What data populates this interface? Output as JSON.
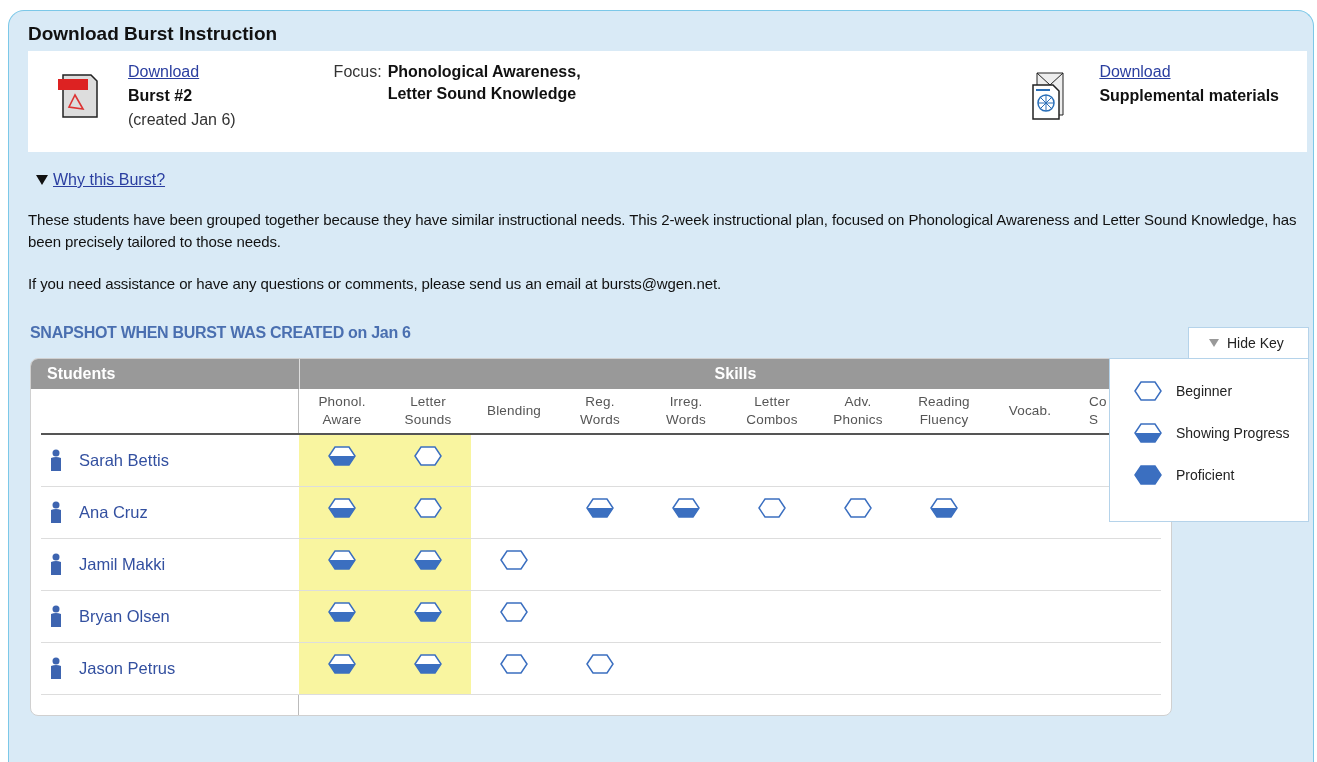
{
  "title": "Download Burst Instruction",
  "downloads": {
    "burst": {
      "link": "Download",
      "name": "Burst #2",
      "created": "(created Jan 6)"
    },
    "focus": {
      "label": "Focus:",
      "lines": [
        "Phonological Awareness,",
        "Letter Sound Knowledge"
      ]
    },
    "supplemental": {
      "link": "Download",
      "name": "Supplemental materials"
    }
  },
  "why": {
    "link": "Why this Burst?",
    "expanded": true
  },
  "paragraphs": [
    "These students have been grouped together because they have similar instructional needs. This 2-week instructional plan, focused on Phonological Awareness and Letter Sound Knowledge, has been precisely tailored to those needs.",
    "If you need assistance or have any questions or comments, please send us an email at bursts@wgen.net."
  ],
  "snapshot_heading": "SNAPSHOT WHEN BURST WAS CREATED on Jan 6",
  "key": {
    "button": "Hide Key",
    "expanded": true,
    "items": [
      {
        "kind": "beginner",
        "label": "Beginner"
      },
      {
        "kind": "progress",
        "label": "Showing Progress"
      },
      {
        "kind": "proficient",
        "label": "Proficient"
      }
    ]
  },
  "table": {
    "students_heading": "Students",
    "skills_heading": "Skills",
    "columns": [
      {
        "lines": [
          "Phonol.",
          "Aware"
        ],
        "highlighted": true
      },
      {
        "lines": [
          "Letter",
          "Sounds"
        ],
        "highlighted": true
      },
      {
        "lines": [
          "Blending"
        ],
        "highlighted": false
      },
      {
        "lines": [
          "Reg.",
          "Words"
        ],
        "highlighted": false
      },
      {
        "lines": [
          "Irreg.",
          "Words"
        ],
        "highlighted": false
      },
      {
        "lines": [
          "Letter",
          "Combos"
        ],
        "highlighted": false
      },
      {
        "lines": [
          "Adv.",
          "Phonics"
        ],
        "highlighted": false
      },
      {
        "lines": [
          "Reading",
          "Fluency"
        ],
        "highlighted": false
      },
      {
        "lines": [
          "Vocab."
        ],
        "highlighted": false
      },
      {
        "lines": [
          "Co",
          "S"
        ],
        "highlighted": false
      }
    ],
    "rows": [
      {
        "name": "Sarah Bettis",
        "skills": [
          {
            "kind": "progress"
          },
          {
            "kind": "beginner"
          },
          {
            "kind": "none"
          },
          {
            "kind": "none"
          },
          {
            "kind": "none"
          },
          {
            "kind": "none"
          },
          {
            "kind": "none"
          },
          {
            "kind": "none"
          },
          {
            "kind": "none"
          },
          {
            "kind": "none"
          }
        ]
      },
      {
        "name": "Ana Cruz",
        "skills": [
          {
            "kind": "progress"
          },
          {
            "kind": "beginner"
          },
          {
            "kind": "none"
          },
          {
            "kind": "progress"
          },
          {
            "kind": "progress"
          },
          {
            "kind": "beginner"
          },
          {
            "kind": "beginner"
          },
          {
            "kind": "progress"
          },
          {
            "kind": "none"
          },
          {
            "kind": "none"
          }
        ]
      },
      {
        "name": "Jamil Makki",
        "skills": [
          {
            "kind": "progress"
          },
          {
            "kind": "progress"
          },
          {
            "kind": "beginner"
          },
          {
            "kind": "none"
          },
          {
            "kind": "none"
          },
          {
            "kind": "none"
          },
          {
            "kind": "none"
          },
          {
            "kind": "none"
          },
          {
            "kind": "none"
          },
          {
            "kind": "none"
          }
        ]
      },
      {
        "name": "Bryan Olsen",
        "skills": [
          {
            "kind": "progress"
          },
          {
            "kind": "progress"
          },
          {
            "kind": "beginner"
          },
          {
            "kind": "none"
          },
          {
            "kind": "none"
          },
          {
            "kind": "none"
          },
          {
            "kind": "none"
          },
          {
            "kind": "none"
          },
          {
            "kind": "none"
          },
          {
            "kind": "none"
          }
        ]
      },
      {
        "name": "Jason Petrus",
        "skills": [
          {
            "kind": "progress"
          },
          {
            "kind": "progress"
          },
          {
            "kind": "beginner"
          },
          {
            "kind": "beginner"
          },
          {
            "kind": "none"
          },
          {
            "kind": "none"
          },
          {
            "kind": "none"
          },
          {
            "kind": "none"
          },
          {
            "kind": "none"
          },
          {
            "kind": "none"
          }
        ]
      }
    ]
  }
}
